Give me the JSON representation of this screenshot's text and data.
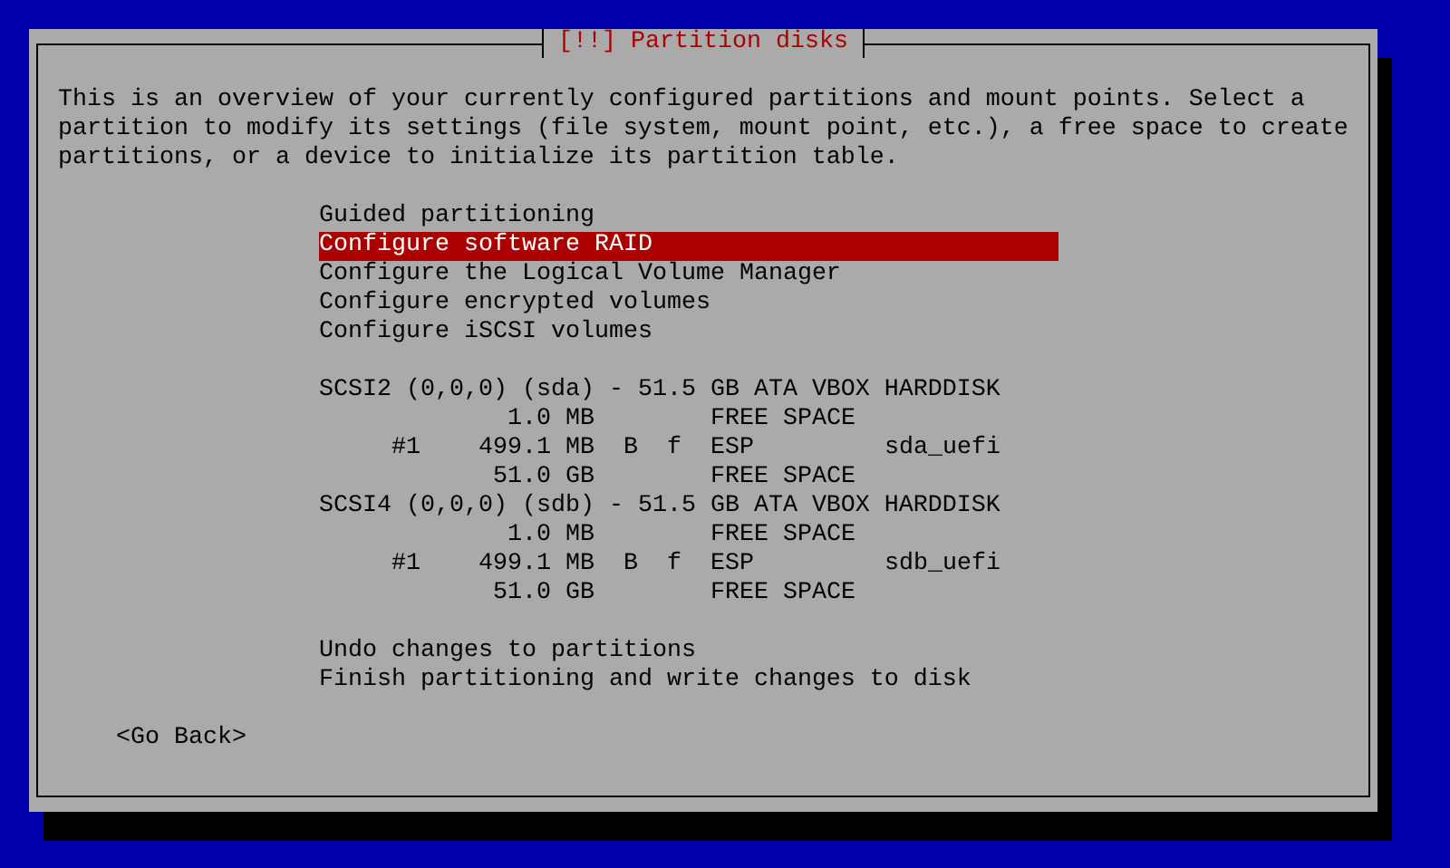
{
  "dialog": {
    "title": "[!!] Partition disks",
    "description": "This is an overview of your currently configured partitions and mount points. Select a partition to modify its settings (file system, mount point, etc.), a free space to create partitions, or a device to initialize its partition table.",
    "options": [
      {
        "label": "Guided partitioning",
        "selected": false
      },
      {
        "label": "Configure software RAID",
        "selected": true
      },
      {
        "label": "Configure the Logical Volume Manager",
        "selected": false
      },
      {
        "label": "Configure encrypted volumes",
        "selected": false
      },
      {
        "label": "Configure iSCSI volumes",
        "selected": false
      }
    ],
    "disks": [
      {
        "label": "SCSI2 (0,0,0) (sda) - 51.5 GB ATA VBOX HARDDISK",
        "selected": false,
        "partitions": [
          {
            "size": "1.0 MB",
            "type": "FREE SPACE",
            "selected": false
          },
          {
            "number": "#1",
            "size": "499.1 MB",
            "boot": "B",
            "format": "f",
            "type": "ESP",
            "name": "sda_uefi",
            "selected": false
          },
          {
            "size": "51.0 GB",
            "type": "FREE SPACE",
            "selected": false
          }
        ]
      },
      {
        "label": "SCSI4 (0,0,0) (sdb) - 51.5 GB ATA VBOX HARDDISK",
        "selected": false,
        "partitions": [
          {
            "size": "1.0 MB",
            "type": "FREE SPACE",
            "selected": false
          },
          {
            "number": "#1",
            "size": "499.1 MB",
            "boot": "B",
            "format": "f",
            "type": "ESP",
            "name": "sdb_uefi",
            "selected": false
          },
          {
            "size": "51.0 GB",
            "type": "FREE SPACE",
            "selected": false
          }
        ]
      }
    ],
    "actions": [
      {
        "label": "Undo changes to partitions",
        "selected": false
      },
      {
        "label": "Finish partitioning and write changes to disk",
        "selected": false
      }
    ],
    "back_button": "<Go Back>"
  }
}
